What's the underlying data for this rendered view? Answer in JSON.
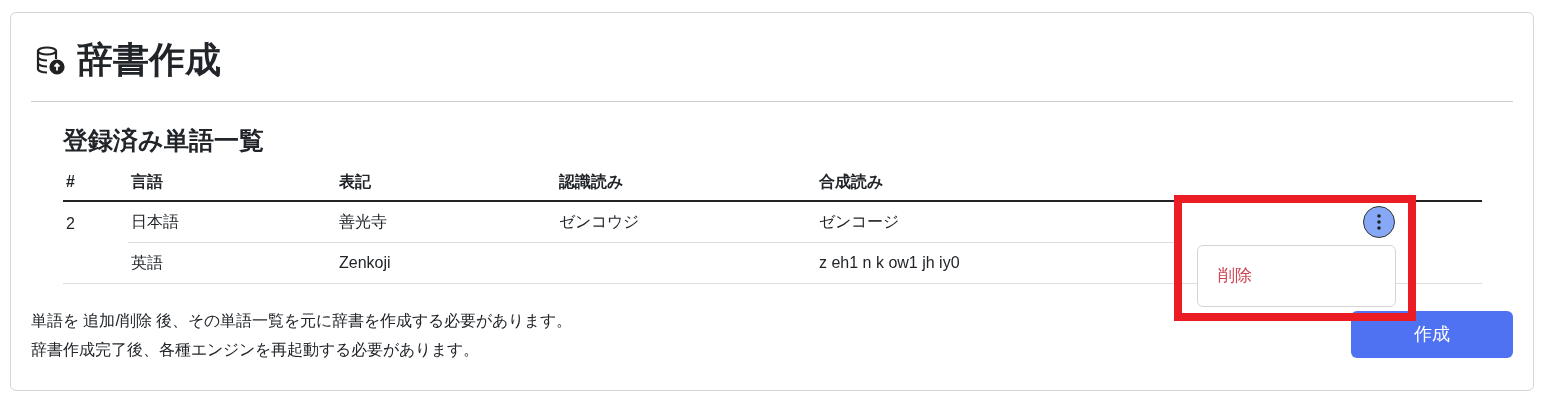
{
  "title": "辞書作成",
  "section_title": "登録済み単語一覧",
  "table": {
    "columns": [
      "#",
      "言語",
      "表記",
      "認識読み",
      "合成読み"
    ],
    "words": [
      {
        "number": "2",
        "menu_open": true,
        "highlighted": true,
        "menu_items": [
          "削除"
        ],
        "entries": [
          {
            "language": "日本語",
            "notation": "善光寺",
            "recognition": "ゼンコウジ",
            "synthesis": "ゼンコージ"
          },
          {
            "language": "英語",
            "notation": "Zenkoji",
            "synthesis": "z eh1 n k ow1 jh iy0"
          }
        ]
      }
    ]
  },
  "notes": [
    "単語を 追加/削除 後、その単語一覧を元に辞書を作成する必要があります。",
    "辞書作成完了後、各種エンジンを再起動する必要があります。"
  ],
  "create_button": "作成"
}
